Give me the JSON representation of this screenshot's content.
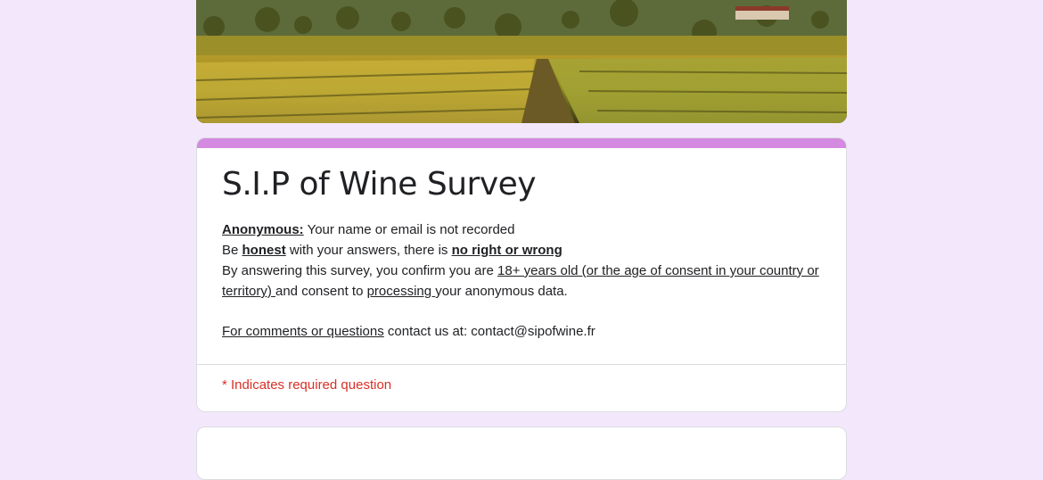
{
  "header_image": {
    "subject": "vineyard-landscape"
  },
  "form": {
    "title": "S.I.P of Wine Survey",
    "accent_color": "#d48ae0",
    "description": {
      "line1": {
        "bold": "Anonymous:",
        "text": " Your name or email is not recorded"
      },
      "line2": {
        "pre": "Be ",
        "bold1": "honest",
        "mid": " with your answers, there is ",
        "bold2": "no right or wrong"
      },
      "line3": {
        "pre": "By answering this survey, you confirm you are ",
        "u1": "18+ years old (or the age of consent in your country or territory) ",
        "mid": "and consent to ",
        "u2": "processing ",
        "post": "your anonymous data."
      },
      "line4": {
        "u": "For comments or questions",
        "post": " contact us at: contact@sipofwine.fr"
      }
    },
    "required_note": "* Indicates required question"
  }
}
